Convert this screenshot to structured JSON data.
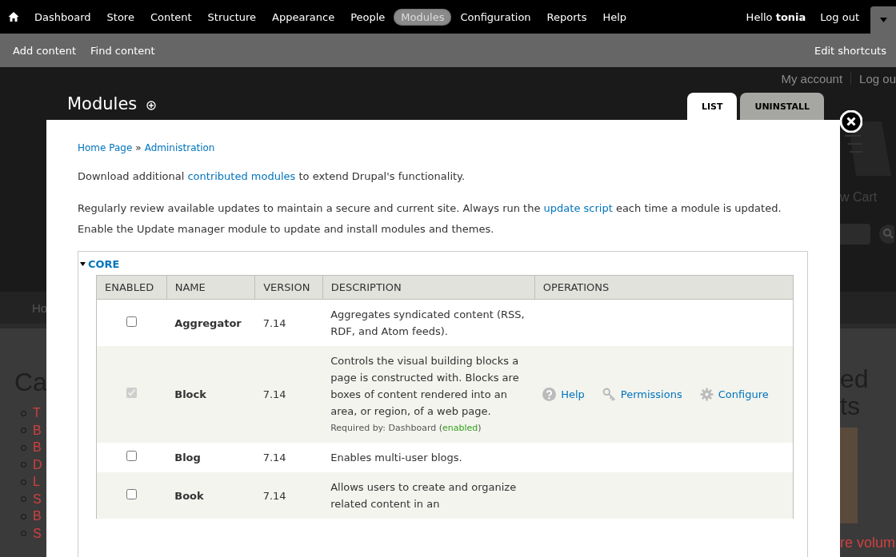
{
  "toolbar": {
    "menu": [
      {
        "label": "Dashboard",
        "selected": false
      },
      {
        "label": "Store",
        "selected": false
      },
      {
        "label": "Content",
        "selected": false
      },
      {
        "label": "Structure",
        "selected": false
      },
      {
        "label": "Appearance",
        "selected": false
      },
      {
        "label": "People",
        "selected": false
      },
      {
        "label": "Modules",
        "selected": true
      },
      {
        "label": "Configuration",
        "selected": false
      },
      {
        "label": "Reports",
        "selected": false
      },
      {
        "label": "Help",
        "selected": false
      }
    ],
    "greeting": "Hello **tonia**",
    "logout": "Log out"
  },
  "shortcuts": {
    "items": [
      "Add content",
      "Find content"
    ],
    "edit": "Edit shortcuts"
  },
  "background_site": {
    "account_links": [
      "My account",
      "Log ou"
    ],
    "nav_left": "Ho",
    "heading_left": "Ca",
    "list_left": [
      "T",
      "B",
      "B",
      "D",
      "L",
      "S",
      "B",
      "S"
    ],
    "cart_label": "w Cart",
    "heading_right": "ed ts",
    "link_right": "re volum"
  },
  "page": {
    "title": "Modules",
    "tabs": [
      {
        "label": "LIST",
        "selected": true
      },
      {
        "label": "UNINSTALL",
        "selected": false
      }
    ]
  },
  "overlay": {
    "breadcrumb": [
      "Home Page",
      "Administration"
    ],
    "breadcrumb_separator": "»",
    "intro": {
      "before": "Download additional ",
      "link": "contributed modules",
      "after": " to extend Drupal's functionality."
    },
    "updates": {
      "before": "Regularly review available updates to maintain a secure and current site. Always run the ",
      "link": "update script",
      "after": " each time a module is updated. Enable the Update manager module to update and install modules and themes."
    },
    "fieldset": {
      "legend": "CORE",
      "expanded": true,
      "columns": [
        "ENABLED",
        "NAME",
        "VERSION",
        "DESCRIPTION",
        "OPERATIONS"
      ],
      "rows": [
        {
          "enabled": false,
          "disabled": false,
          "name": "Aggregator",
          "version": "7.14",
          "description": "Aggregates syndicated content (RSS, RDF, and Atom feeds).",
          "operations": []
        },
        {
          "enabled": true,
          "disabled": true,
          "name": "Block",
          "version": "7.14",
          "description": "Controls the visual building blocks a page is constructed with. Blocks are boxes of content rendered into an area, or region, of a web page.",
          "required_note": {
            "prefix": "Required by: Dashboard (",
            "status": "enabled",
            "suffix": ")"
          },
          "operations": [
            {
              "kind": "help",
              "label": "Help"
            },
            {
              "kind": "permissions",
              "label": "Permissions"
            },
            {
              "kind": "configure",
              "label": "Configure"
            }
          ]
        },
        {
          "enabled": false,
          "disabled": false,
          "name": "Blog",
          "version": "7.14",
          "description": "Enables multi-user blogs.",
          "operations": []
        },
        {
          "enabled": false,
          "disabled": false,
          "name": "Book",
          "version": "7.14",
          "description": "Allows users to create and organize related content in an",
          "operations": []
        }
      ]
    }
  }
}
